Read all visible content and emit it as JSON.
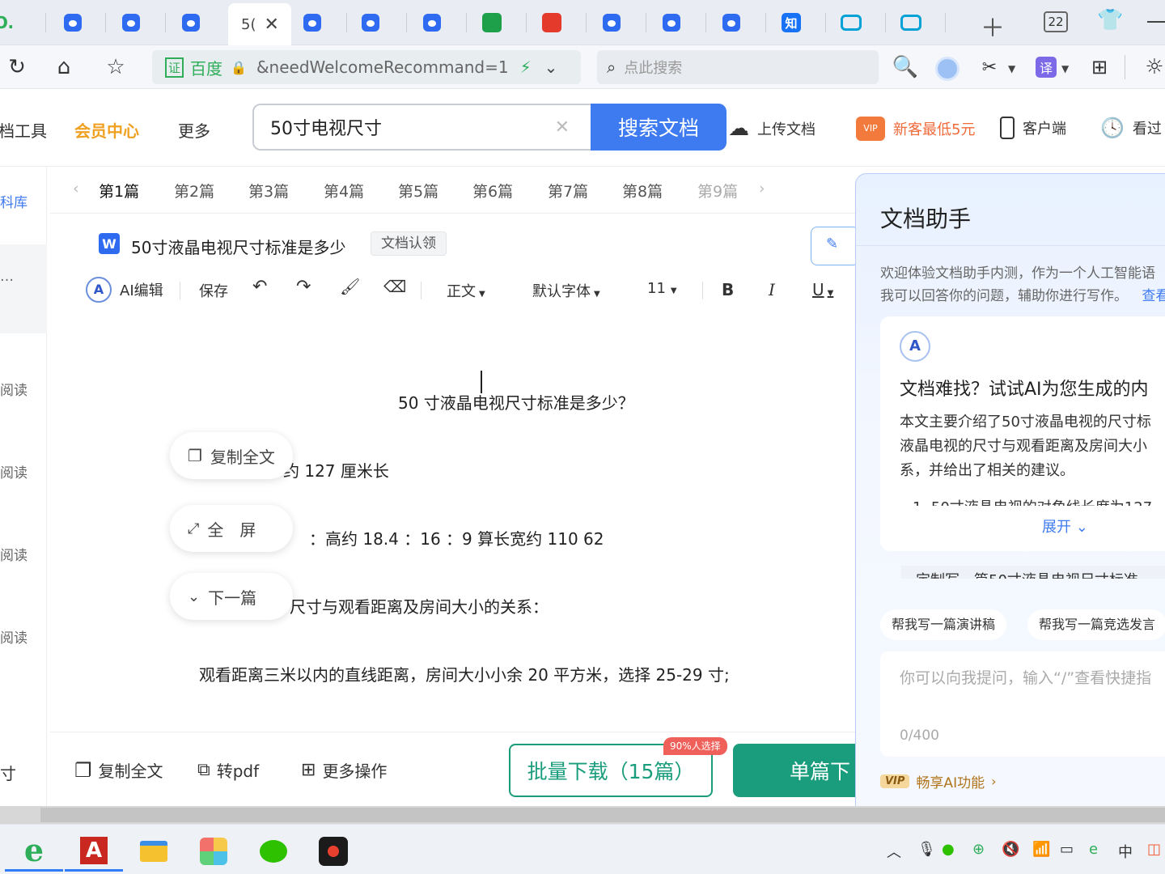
{
  "browser": {
    "tabs": [
      {
        "icon": "qihoo-logo-icon",
        "label": "O."
      },
      {
        "icon": "baidu-paw-icon",
        "label": ""
      },
      {
        "icon": "baidu-paw-icon",
        "label": ""
      },
      {
        "icon": "baidu-paw-icon",
        "label": ""
      },
      {
        "icon": "doc-tab-icon",
        "label": "5("
      },
      {
        "icon": "baidu-paw-icon",
        "label": ""
      },
      {
        "icon": "baidu-paw-icon",
        "label": ""
      },
      {
        "icon": "baidu-paw-icon",
        "label": ""
      },
      {
        "icon": "green-tool-icon",
        "label": ""
      },
      {
        "icon": "red-grid-icon",
        "label": ""
      },
      {
        "icon": "baidu-paw-icon",
        "label": ""
      },
      {
        "icon": "baidu-paw-icon",
        "label": ""
      },
      {
        "icon": "baidu-paw-icon",
        "label": ""
      },
      {
        "icon": "zhihu-icon",
        "label": "知"
      },
      {
        "icon": "bilibili-icon",
        "label": ""
      },
      {
        "icon": "bilibili-icon",
        "label": ""
      }
    ],
    "tab_count": "22",
    "url_cert": "证",
    "url_site": "百度",
    "url_text": "&needWelcomeRecommand=1",
    "search_placeholder": "点此搜索",
    "translate": "译"
  },
  "site": {
    "nav_tools": "档工具",
    "nav_vip": "会员中心",
    "nav_more": "更多",
    "search_value": "50寸电视尺寸",
    "search_button": "搜索文档",
    "upload": "上传文档",
    "vip_badge": "VIP",
    "promo": "新客最低5元",
    "client": "客户端",
    "history": "看过"
  },
  "left_rail": [
    "科库",
    "…",
    "阅读",
    "阅读",
    "阅读",
    "阅读",
    "寸"
  ],
  "chapters": [
    "第1篇",
    "第2篇",
    "第3篇",
    "第4篇",
    "第5篇",
    "第6篇",
    "第7篇",
    "第8篇",
    "第9篇"
  ],
  "doc": {
    "word_icon": "W",
    "title": "50寸液晶电视尺寸标准是多少",
    "claim": "文档认领",
    "toolbar": {
      "ai_edit": "AI编辑",
      "save": "保存",
      "style": "正文",
      "font": "默认字体",
      "size": "11",
      "bold": "B",
      "italic": "I",
      "underline": "U"
    },
    "paragraphs": [
      "50 寸液晶电视尺寸标准是多少？",
      "约 127 厘米长",
      "：高约 18.4  ：16  ：9  算长宽约  110 62",
      "尺寸与观看距离及房间大小的关系：",
      "观看距离三米以内的直线距离，房间大小小余 20 平方米，选择 25-29 寸;"
    ],
    "float_copy": "复制全文",
    "float_full": "全　屏",
    "float_next": "下一篇",
    "bottom_copy": "复制全文",
    "bottom_pdf": "转pdf",
    "bottom_more": "更多操作",
    "batch_download": "批量下载（15篇）",
    "batch_badge": "90%人选择",
    "single_download": "单篇下"
  },
  "assistant": {
    "title": "文档助手",
    "intro_line1": "欢迎体验文档助手内测，作为一个人工智能语",
    "intro_line2": "我可以回答你的问题，辅助你进行写作。",
    "intro_link": "查看",
    "card_heading": "文档难找？试试AI为您生成的内",
    "card_line1": "本文主要介绍了50寸液晶电视的尺寸标",
    "card_line2": "液晶电视的尺寸与观看距离及房间大小",
    "card_line3": "系，并给出了相关的建议。",
    "card_cut": "1. 50寸液晶电视的对角线长度为127",
    "expand": "展开",
    "suggest_cut": "定制写一篇50寸液晶电视尺寸标准",
    "chip1": "帮我写一篇演讲稿",
    "chip2": "帮我写一篇竞选发言",
    "input_placeholder": "你可以向我提问，输入“/”查看快捷指",
    "counter": "0/400",
    "vip": "VIP",
    "vip_text": "畅享AI功能"
  },
  "taskbar": {
    "ime": "中"
  },
  "colors": {
    "primary": "#3f7bf0",
    "vip_orange": "#f0a020",
    "download_green": "#1a9d7c",
    "badge_red": "#f0605a"
  }
}
